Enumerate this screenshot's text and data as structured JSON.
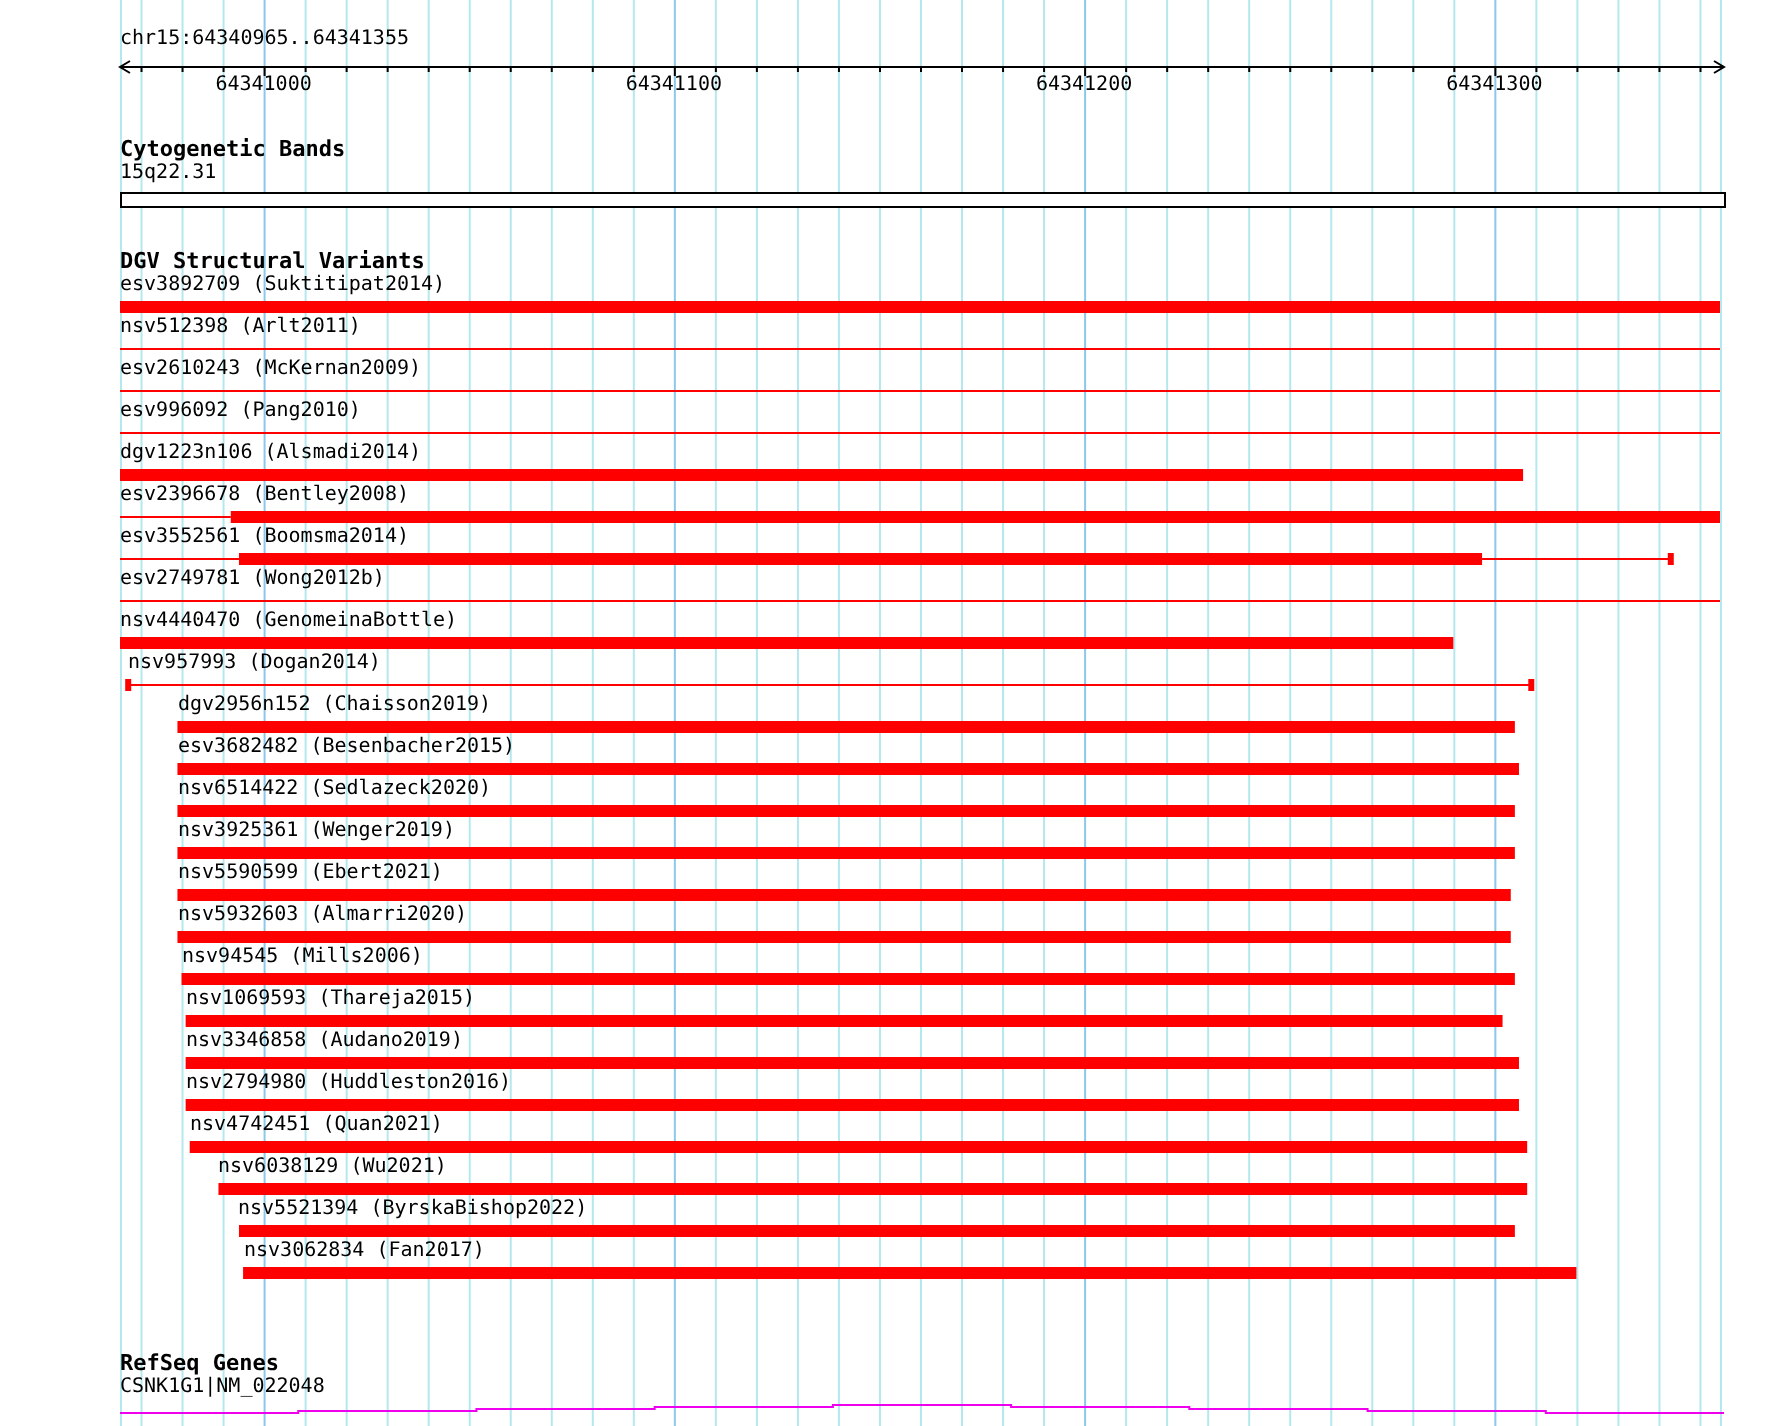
{
  "location": "chr15:64340965..64341355",
  "ruler": {
    "ticks": [
      {
        "label": "64341000"
      },
      {
        "label": "64341100"
      },
      {
        "label": "64341200"
      },
      {
        "label": "64341300"
      }
    ]
  },
  "tracks": [
    {
      "kind": "cytoband",
      "title": "Cytogenetic Bands",
      "features": [
        {
          "label": "15q22.31"
        }
      ]
    },
    {
      "kind": "variants",
      "title": "DGV Structural Variants",
      "features": [
        {
          "label": "esv3892709 (Suktitipat2014)",
          "segments": [
            {
              "kind": "thick"
            }
          ]
        },
        {
          "label": "nsv512398 (Arlt2011)",
          "segments": [
            {
              "kind": "thin"
            }
          ]
        },
        {
          "label": "esv2610243 (McKernan2009)",
          "segments": [
            {
              "kind": "thin"
            }
          ]
        },
        {
          "label": "esv996092 (Pang2010)",
          "segments": [
            {
              "kind": "thin"
            }
          ]
        },
        {
          "label": "dgv1223n106 (Alsmadi2014)",
          "segments": [
            {
              "kind": "thick"
            }
          ]
        },
        {
          "label": "esv2396678 (Bentley2008)",
          "segments": [
            {
              "kind": "thin"
            },
            {
              "kind": "thick"
            }
          ]
        },
        {
          "label": "esv3552561 (Boomsma2014)",
          "segments": [
            {
              "kind": "thin"
            },
            {
              "kind": "thick"
            },
            {
              "kind": "thin"
            },
            {
              "kind": "cap"
            }
          ]
        },
        {
          "label": "esv2749781 (Wong2012b)",
          "segments": [
            {
              "kind": "thin"
            }
          ]
        },
        {
          "label": "nsv4440470 (GenomeinaBottle)",
          "segments": [
            {
              "kind": "thick"
            }
          ]
        },
        {
          "label": "nsv957993 (Dogan2014)",
          "segments": [
            {
              "kind": "cap"
            },
            {
              "kind": "thin"
            },
            {
              "kind": "cap"
            }
          ]
        },
        {
          "label": "dgv2956n152 (Chaisson2019)",
          "segments": [
            {
              "kind": "thick"
            }
          ]
        },
        {
          "label": "esv3682482 (Besenbacher2015)",
          "segments": [
            {
              "kind": "thick"
            }
          ]
        },
        {
          "label": "nsv6514422 (Sedlazeck2020)",
          "segments": [
            {
              "kind": "thick"
            }
          ]
        },
        {
          "label": "nsv3925361 (Wenger2019)",
          "segments": [
            {
              "kind": "thick"
            }
          ]
        },
        {
          "label": "nsv5590599 (Ebert2021)",
          "segments": [
            {
              "kind": "thick"
            }
          ]
        },
        {
          "label": "nsv5932603 (Almarri2020)",
          "segments": [
            {
              "kind": "thick"
            }
          ]
        },
        {
          "label": "nsv94545 (Mills2006)",
          "segments": [
            {
              "kind": "thick"
            }
          ]
        },
        {
          "label": "nsv1069593 (Thareja2015)",
          "segments": [
            {
              "kind": "thick"
            }
          ]
        },
        {
          "label": "nsv3346858 (Audano2019)",
          "segments": [
            {
              "kind": "thick"
            }
          ]
        },
        {
          "label": "nsv2794980 (Huddleston2016)",
          "segments": [
            {
              "kind": "thick"
            }
          ]
        },
        {
          "label": "nsv4742451 (Quan2021)",
          "segments": [
            {
              "kind": "thick"
            }
          ]
        },
        {
          "label": "nsv6038129 (Wu2021)",
          "segments": [
            {
              "kind": "thick"
            }
          ]
        },
        {
          "label": "nsv5521394 (ByrskaBishop2022)",
          "segments": [
            {
              "kind": "thick"
            }
          ]
        },
        {
          "label": "nsv3062834 (Fan2017)",
          "segments": [
            {
              "kind": "thick"
            }
          ]
        }
      ]
    },
    {
      "kind": "genes",
      "title": "RefSeq Genes",
      "features": [
        {
          "label": "CSNK1G1|NM_022048"
        }
      ]
    }
  ]
}
